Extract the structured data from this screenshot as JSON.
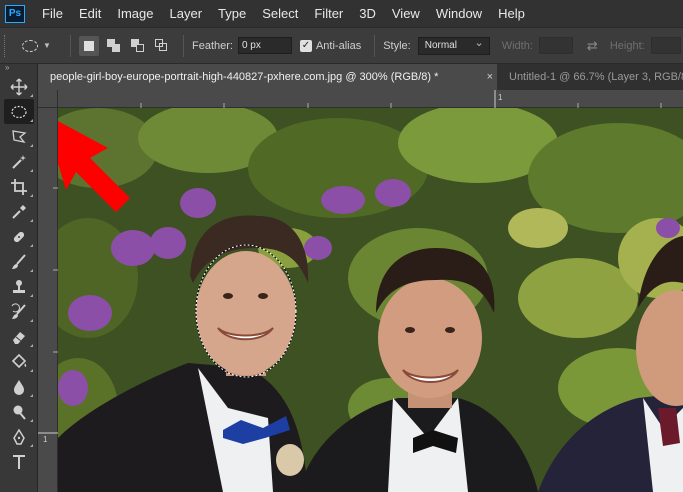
{
  "app": {
    "logo_text": "Ps"
  },
  "menu": [
    "File",
    "Edit",
    "Image",
    "Layer",
    "Type",
    "Select",
    "Filter",
    "3D",
    "View",
    "Window",
    "Help"
  ],
  "options": {
    "feather_label": "Feather:",
    "feather_value": "0 px",
    "antialias_label": "Anti-alias",
    "antialias_checked": true,
    "style_label": "Style:",
    "style_value": "Normal",
    "width_label": "Width:",
    "height_label": "Height:"
  },
  "tabs": [
    {
      "label": "people-girl-boy-europe-portrait-high-440827-pxhere.com.jpg @ 300% (RGB/8) *",
      "active": true,
      "close": "×"
    },
    {
      "label": "Untitled-1 @ 66.7% (Layer 3, RGB/8)",
      "active": false
    }
  ],
  "rulers": {
    "h_label": "1",
    "v_label": "1"
  },
  "toolbar": {
    "collapse": "»",
    "tools": [
      "move-icon",
      "elliptical-marquee-icon",
      "polygonal-lasso-icon",
      "magic-wand-icon",
      "crop-icon",
      "eyedropper-icon",
      "healing-brush-icon",
      "brush-icon",
      "clone-stamp-icon",
      "history-brush-icon",
      "eraser-icon",
      "paint-bucket-icon",
      "blur-icon",
      "dodge-icon",
      "pen-icon",
      "type-icon"
    ],
    "active_tool": "elliptical-marquee-icon"
  },
  "colors": {
    "annotation_arrow": "#ff0000",
    "accent": "#31a8ff"
  }
}
